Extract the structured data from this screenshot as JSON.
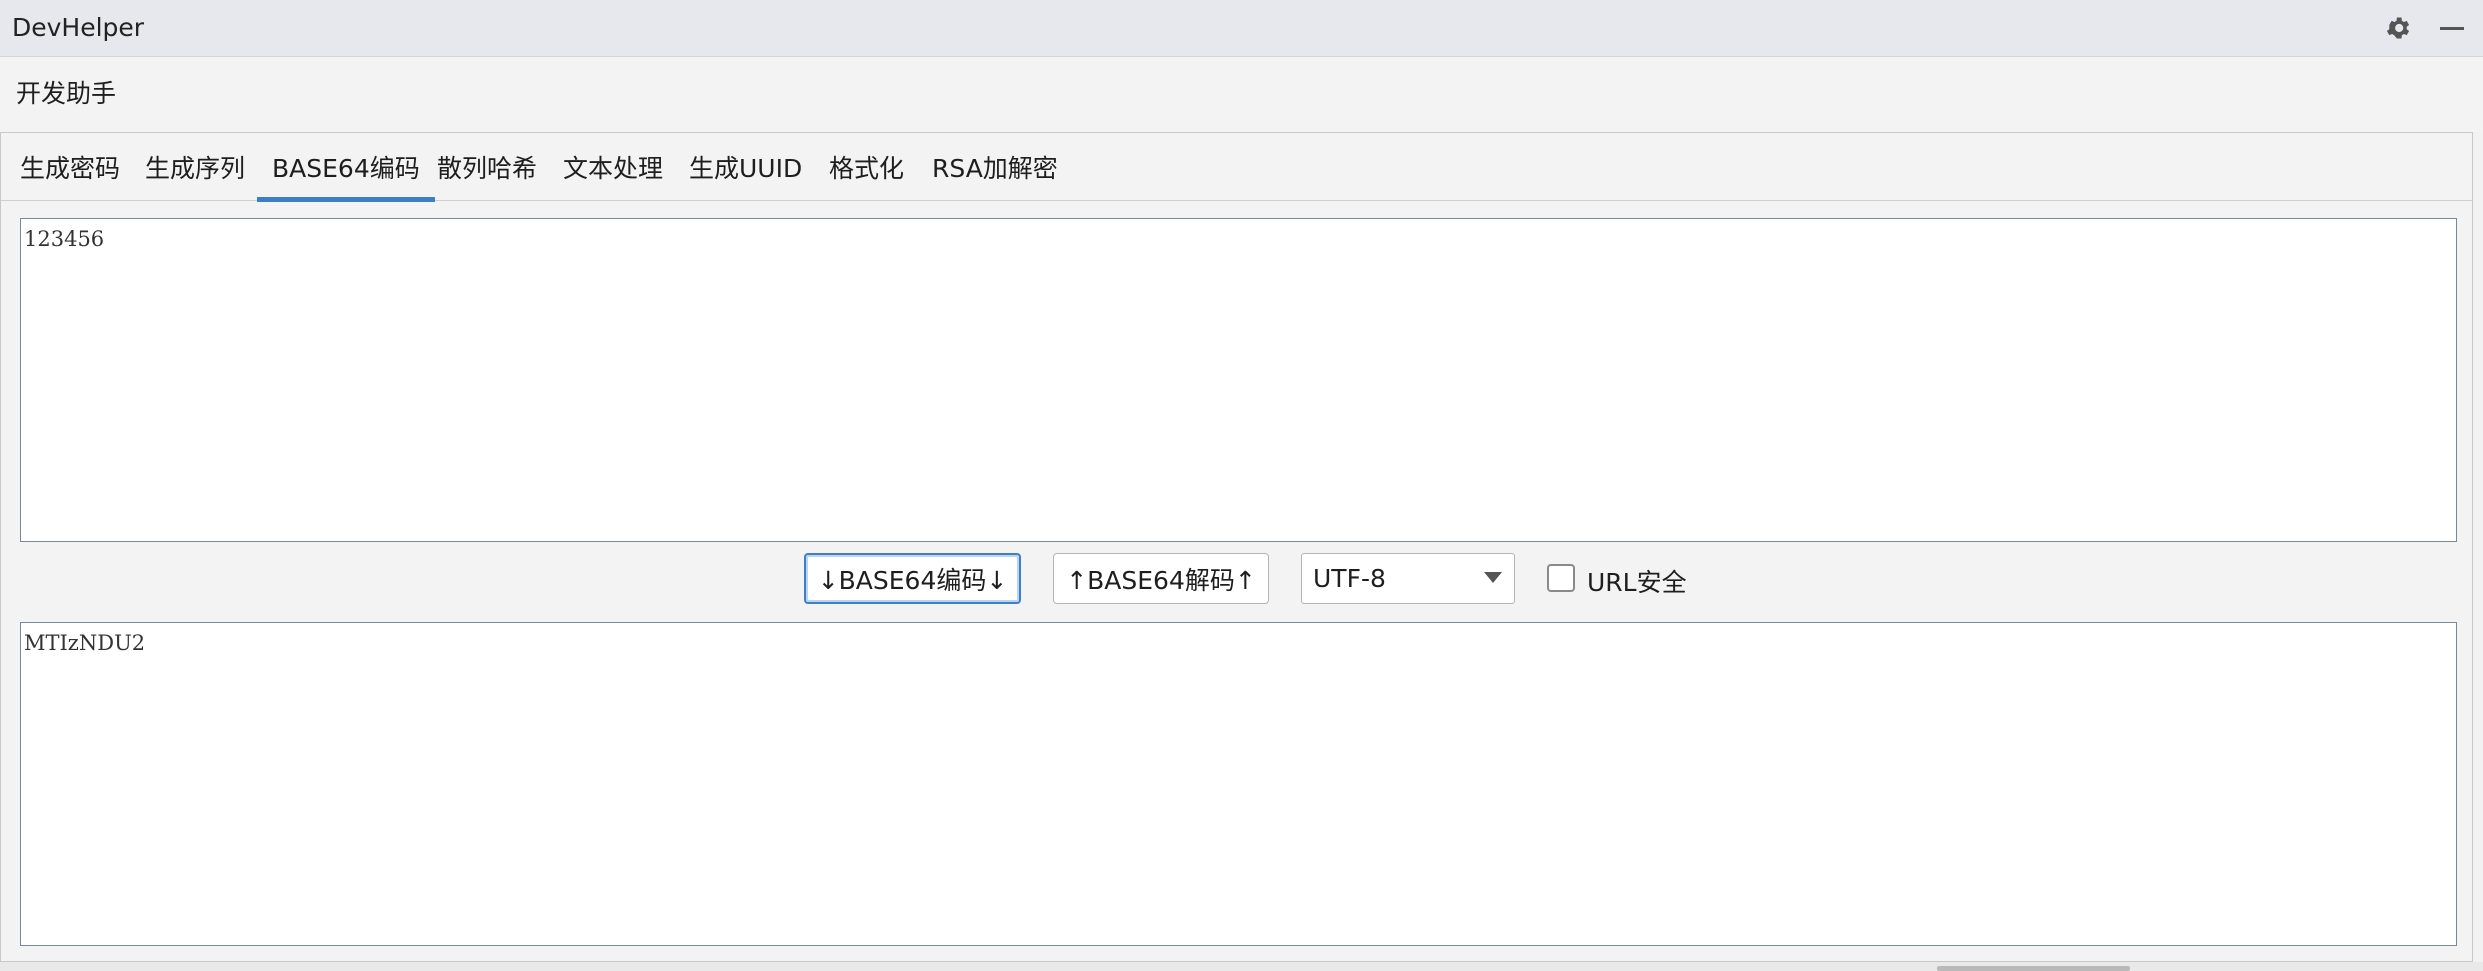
{
  "window": {
    "title": "DevHelper"
  },
  "header": {
    "label": "开发助手"
  },
  "tabs": [
    {
      "label": "生成密码"
    },
    {
      "label": "生成序列"
    },
    {
      "label": "BASE64编码",
      "active": true
    },
    {
      "label": "散列哈希"
    },
    {
      "label": "文本处理"
    },
    {
      "label": "生成UUID"
    },
    {
      "label": "格式化"
    },
    {
      "label": "RSA加解密"
    }
  ],
  "input": {
    "value": "123456"
  },
  "output": {
    "value": "MTIzNDU2"
  },
  "controls": {
    "encode_label": "↓BASE64编码↓",
    "decode_label": "↑BASE64解码↑",
    "charset": {
      "selected": "UTF-8"
    },
    "url_safe": {
      "label": "URL安全",
      "checked": false
    }
  },
  "icons": {
    "settings": "gear-icon",
    "minimize": "minimize-icon",
    "dropdown": "chevron-down-icon"
  },
  "colors": {
    "accent": "#3d7fc4",
    "titlebar": "#e6e8ee"
  }
}
